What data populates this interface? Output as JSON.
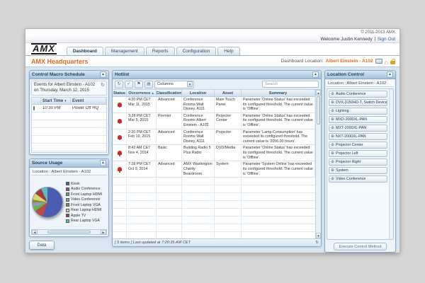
{
  "header": {
    "copyright": "© 2011-2013 AMX",
    "welcome": "Welcome Justin Kennedy",
    "sign_out_label": "Sign Out",
    "logo_text": "AMX",
    "tabs": [
      "Dashboard",
      "Management",
      "Reports",
      "Configuration",
      "Help"
    ],
    "active_tab": "Dashboard",
    "page_title": "AMX Headquarters",
    "location_label": "Dashboard Location:",
    "location_value": "Albert Einstein - A102"
  },
  "schedule": {
    "title": "Control Macro Schedule",
    "info": "Events for Albert Einstein - A102 on Thursday, March 12, 2015",
    "col_time": "Start Time",
    "col_event": "Event",
    "rows": [
      {
        "time": "10:30 PM",
        "event": "Power Off HQ"
      }
    ]
  },
  "source_usage": {
    "title": "Source Usage",
    "location": "Location : Albert Einstein - A102",
    "data_button_label": "Data"
  },
  "chart_data": {
    "type": "pie",
    "title": "Source Usage",
    "legend_position": "right",
    "slices": [
      {
        "label": "Kiosk",
        "value": 55,
        "color": "#4a5db0"
      },
      {
        "label": "Audio Conference",
        "value": 10,
        "color": "#b94a48"
      },
      {
        "label": "Front Laptop HDMI",
        "value": 5,
        "color": "#6ab04c"
      },
      {
        "label": "Video Conference",
        "value": 5,
        "color": "#8ba0ae"
      },
      {
        "label": "Front Laptop VGA",
        "value": 3,
        "color": "#8a8a3a"
      },
      {
        "label": "Rear Laptop HDMI",
        "value": 7,
        "color": "#d8d870"
      },
      {
        "label": "Apple TV",
        "value": 8,
        "color": "#a03c3c"
      },
      {
        "label": "Rear Laptop VGA",
        "value": 7,
        "color": "#5fbcbc"
      }
    ]
  },
  "hotlist": {
    "title": "Hotlist",
    "columns_dropdown_label": "Columns",
    "search_placeholder": "Search",
    "columns": [
      "Status",
      "Occurrence",
      "Classification",
      "Location",
      "Asset",
      "Summary"
    ],
    "sorted_column": "Occurrence",
    "rows": [
      {
        "time": "4:20 PM CET",
        "date": "Mar 11, 2015",
        "classification": "Advanced",
        "location": "Conference Rooms Walt Disney, A111",
        "asset": "Main Touch Panel",
        "summary": "Parameter 'Online Status' has exceeded its configured threshold. The current value is 'Offline'."
      },
      {
        "time": "3:28 PM CET",
        "date": "Mar 5, 2015",
        "classification": "Premier",
        "location": "Conference Rooms Albert Einstein - A102",
        "asset": "Projector Center",
        "summary": "Parameter 'Online Status' has exceeded its configured threshold. The current value is 'Offline'."
      },
      {
        "time": "2:20 PM CET",
        "date": "Feb 19, 2015",
        "classification": "Advanced",
        "location": "Conference Rooms Walt Disney, A111",
        "asset": "Projector",
        "summary": "Parameter 'Lamp Consumption' has exceeded its configured threshold. The current value is '2056.00 hours'."
      },
      {
        "time": "8:42 AM CET",
        "date": "Nov 4, 2014",
        "classification": "Basic",
        "location": "Building Radio 5 Plus Radio",
        "asset": "DVD/Media",
        "summary": "Parameter 'Online Status' has exceeded its configured threshold. The current value is 'Offline'."
      },
      {
        "time": "7:28 PM CET",
        "date": "Oct 9, 2014",
        "classification": "Advanced",
        "location": "AMX Washington Charity Boardroom",
        "asset": "System",
        "summary": "Parameter 'System Online' has exceeded its configured threshold. The current value is 'Offline'."
      }
    ],
    "status_bar": "[ 5 items ]  Last updated at 7:20:35 AM CET"
  },
  "location_control": {
    "title": "Location Control",
    "location": "Location : Albert Einstein - A102",
    "items": [
      "Audio Conference",
      "DVX-3150HD-T, Switch Device",
      "Lighting",
      "MXD-2000XL-PAN",
      "MXT-2000XL-PAN",
      "NXT-2000XL-PAN",
      "Projector Center",
      "Projector Left",
      "Projector Right",
      "System",
      "Video Conference"
    ],
    "execute_button_label": "Execute Control Method"
  }
}
